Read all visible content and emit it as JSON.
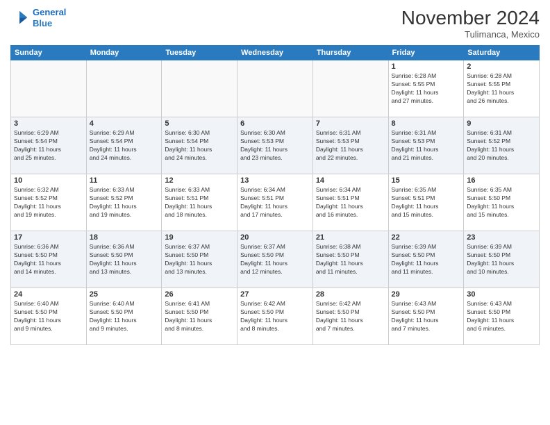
{
  "header": {
    "logo_line1": "General",
    "logo_line2": "Blue",
    "month": "November 2024",
    "location": "Tulimanca, Mexico"
  },
  "weekdays": [
    "Sunday",
    "Monday",
    "Tuesday",
    "Wednesday",
    "Thursday",
    "Friday",
    "Saturday"
  ],
  "weeks": [
    [
      {
        "day": "",
        "info": ""
      },
      {
        "day": "",
        "info": ""
      },
      {
        "day": "",
        "info": ""
      },
      {
        "day": "",
        "info": ""
      },
      {
        "day": "",
        "info": ""
      },
      {
        "day": "1",
        "info": "Sunrise: 6:28 AM\nSunset: 5:55 PM\nDaylight: 11 hours\nand 27 minutes."
      },
      {
        "day": "2",
        "info": "Sunrise: 6:28 AM\nSunset: 5:55 PM\nDaylight: 11 hours\nand 26 minutes."
      }
    ],
    [
      {
        "day": "3",
        "info": "Sunrise: 6:29 AM\nSunset: 5:54 PM\nDaylight: 11 hours\nand 25 minutes."
      },
      {
        "day": "4",
        "info": "Sunrise: 6:29 AM\nSunset: 5:54 PM\nDaylight: 11 hours\nand 24 minutes."
      },
      {
        "day": "5",
        "info": "Sunrise: 6:30 AM\nSunset: 5:54 PM\nDaylight: 11 hours\nand 24 minutes."
      },
      {
        "day": "6",
        "info": "Sunrise: 6:30 AM\nSunset: 5:53 PM\nDaylight: 11 hours\nand 23 minutes."
      },
      {
        "day": "7",
        "info": "Sunrise: 6:31 AM\nSunset: 5:53 PM\nDaylight: 11 hours\nand 22 minutes."
      },
      {
        "day": "8",
        "info": "Sunrise: 6:31 AM\nSunset: 5:53 PM\nDaylight: 11 hours\nand 21 minutes."
      },
      {
        "day": "9",
        "info": "Sunrise: 6:31 AM\nSunset: 5:52 PM\nDaylight: 11 hours\nand 20 minutes."
      }
    ],
    [
      {
        "day": "10",
        "info": "Sunrise: 6:32 AM\nSunset: 5:52 PM\nDaylight: 11 hours\nand 19 minutes."
      },
      {
        "day": "11",
        "info": "Sunrise: 6:33 AM\nSunset: 5:52 PM\nDaylight: 11 hours\nand 19 minutes."
      },
      {
        "day": "12",
        "info": "Sunrise: 6:33 AM\nSunset: 5:51 PM\nDaylight: 11 hours\nand 18 minutes."
      },
      {
        "day": "13",
        "info": "Sunrise: 6:34 AM\nSunset: 5:51 PM\nDaylight: 11 hours\nand 17 minutes."
      },
      {
        "day": "14",
        "info": "Sunrise: 6:34 AM\nSunset: 5:51 PM\nDaylight: 11 hours\nand 16 minutes."
      },
      {
        "day": "15",
        "info": "Sunrise: 6:35 AM\nSunset: 5:51 PM\nDaylight: 11 hours\nand 15 minutes."
      },
      {
        "day": "16",
        "info": "Sunrise: 6:35 AM\nSunset: 5:50 PM\nDaylight: 11 hours\nand 15 minutes."
      }
    ],
    [
      {
        "day": "17",
        "info": "Sunrise: 6:36 AM\nSunset: 5:50 PM\nDaylight: 11 hours\nand 14 minutes."
      },
      {
        "day": "18",
        "info": "Sunrise: 6:36 AM\nSunset: 5:50 PM\nDaylight: 11 hours\nand 13 minutes."
      },
      {
        "day": "19",
        "info": "Sunrise: 6:37 AM\nSunset: 5:50 PM\nDaylight: 11 hours\nand 13 minutes."
      },
      {
        "day": "20",
        "info": "Sunrise: 6:37 AM\nSunset: 5:50 PM\nDaylight: 11 hours\nand 12 minutes."
      },
      {
        "day": "21",
        "info": "Sunrise: 6:38 AM\nSunset: 5:50 PM\nDaylight: 11 hours\nand 11 minutes."
      },
      {
        "day": "22",
        "info": "Sunrise: 6:39 AM\nSunset: 5:50 PM\nDaylight: 11 hours\nand 11 minutes."
      },
      {
        "day": "23",
        "info": "Sunrise: 6:39 AM\nSunset: 5:50 PM\nDaylight: 11 hours\nand 10 minutes."
      }
    ],
    [
      {
        "day": "24",
        "info": "Sunrise: 6:40 AM\nSunset: 5:50 PM\nDaylight: 11 hours\nand 9 minutes."
      },
      {
        "day": "25",
        "info": "Sunrise: 6:40 AM\nSunset: 5:50 PM\nDaylight: 11 hours\nand 9 minutes."
      },
      {
        "day": "26",
        "info": "Sunrise: 6:41 AM\nSunset: 5:50 PM\nDaylight: 11 hours\nand 8 minutes."
      },
      {
        "day": "27",
        "info": "Sunrise: 6:42 AM\nSunset: 5:50 PM\nDaylight: 11 hours\nand 8 minutes."
      },
      {
        "day": "28",
        "info": "Sunrise: 6:42 AM\nSunset: 5:50 PM\nDaylight: 11 hours\nand 7 minutes."
      },
      {
        "day": "29",
        "info": "Sunrise: 6:43 AM\nSunset: 5:50 PM\nDaylight: 11 hours\nand 7 minutes."
      },
      {
        "day": "30",
        "info": "Sunrise: 6:43 AM\nSunset: 5:50 PM\nDaylight: 11 hours\nand 6 minutes."
      }
    ]
  ]
}
